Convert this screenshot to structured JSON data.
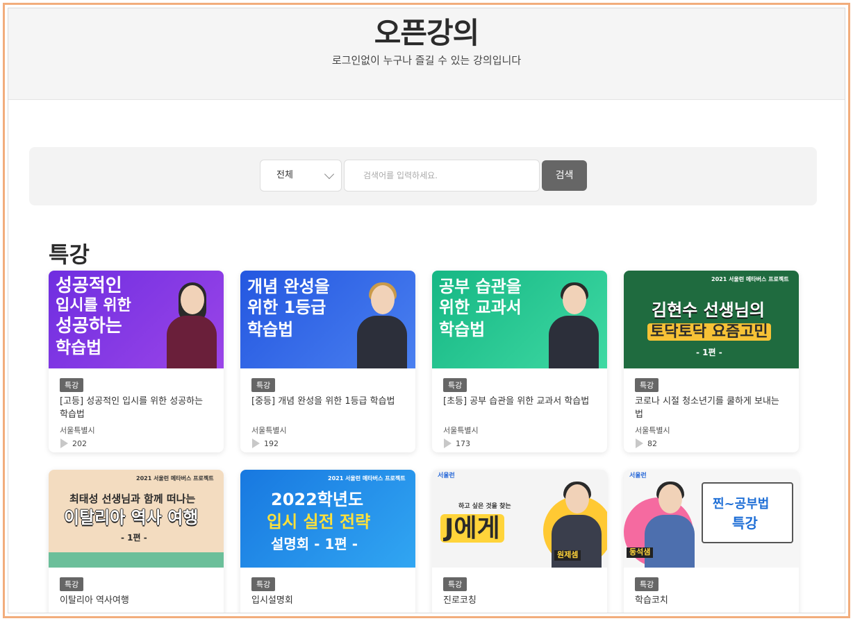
{
  "hero": {
    "title": "오픈강의",
    "subtitle": "로그인없이 누구나 즐길 수 있는 강의입니다"
  },
  "search": {
    "select_value": "전체",
    "placeholder": "검색어를 입력하세요.",
    "button_label": "검색"
  },
  "section": {
    "title": "특강"
  },
  "colors": {
    "frame_border": "#f2ad7c",
    "tag_bg": "#666666",
    "search_button_bg": "#666666"
  },
  "cards": [
    {
      "tag": "특강",
      "title": "[고등] 성공적인 입시를 위한 성공하는 학습법",
      "region": "서울특별시",
      "views": "202",
      "thumb_lines": [
        "성공적인",
        "입시를 위한",
        "성공하는",
        "학습법"
      ],
      "thumb_bg": "#8a3bdb"
    },
    {
      "tag": "특강",
      "title": "[중등] 개념 완성을 위한 1등급 학습법",
      "region": "서울특별시",
      "views": "192",
      "thumb_lines": [
        "개념 완성을",
        "위한 1등급",
        "학습법"
      ],
      "thumb_bg": "#2f63e6"
    },
    {
      "tag": "특강",
      "title": "[초등] 공부 습관을 위한 교과서 학습법",
      "region": "서울특별시",
      "views": "173",
      "thumb_lines": [
        "공부 습관을",
        "위한 교과서",
        "학습법"
      ],
      "thumb_bg": "#22c58e"
    },
    {
      "tag": "특강",
      "title": "코로나 시절 청소년기를 쿨하게 보내는 법",
      "region": "서울특별시",
      "views": "82",
      "thumb_lines": [
        "2021 서울런 메타버스 프로젝트",
        "김현수 선생님의",
        "토닥토닥 요즘고민",
        "- 1편 -"
      ],
      "thumb_bg": "#1f6b3f"
    },
    {
      "tag": "특강",
      "title": "이탈리아 역사여행",
      "thumb_lines": [
        "2021 서울런 메타버스 프로젝트",
        "최태성 선생님과 함께 떠나는",
        "이탈리아 역사 여행",
        "- 1편 -"
      ],
      "thumb_bg": "#f3dcc0"
    },
    {
      "tag": "특강",
      "title": "입시설명회",
      "thumb_lines": [
        "2021 서울런 메타버스 프로젝트",
        "2022학년도",
        "입시 실전 전략",
        "설명회 - 1편 -"
      ],
      "thumb_bg": "#1f8fe8"
    },
    {
      "tag": "특강",
      "title": "진로코칭",
      "thumb_lines": [
        "서울런",
        "하고 싶은 것을 찾는",
        "J에게",
        "원제셈"
      ],
      "thumb_bg": "#f4f4f4"
    },
    {
      "tag": "특강",
      "title": "학습코치",
      "thumb_lines": [
        "서울런",
        "찐~공부법",
        "특강",
        "동석샘"
      ],
      "thumb_bg": "#f6f6f6"
    }
  ]
}
